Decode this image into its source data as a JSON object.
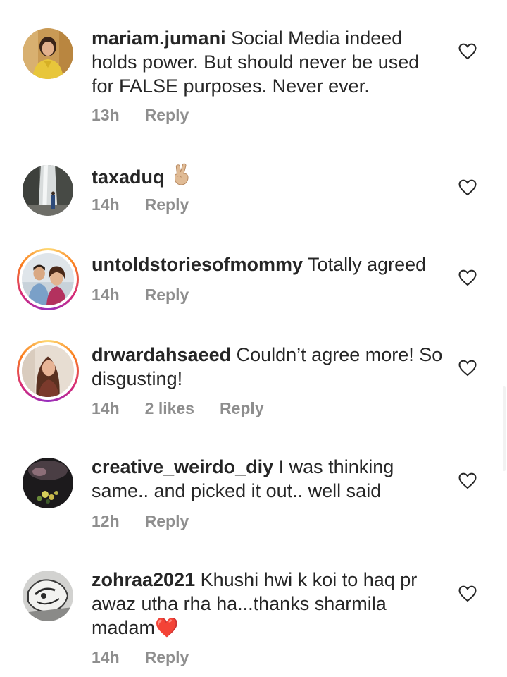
{
  "comments": [
    {
      "username": "mariam.jumani",
      "text": "Social Media indeed holds power. But should never be used for FALSE purposes. Never ever.",
      "time": "13h",
      "likes": "",
      "reply": "Reply",
      "avatar": "woman-yellow-dress-photo",
      "story_ring": false
    },
    {
      "username": "taxaduq",
      "text": "✌️",
      "time": "14h",
      "likes": "",
      "reply": "Reply",
      "avatar": "waterfall-person-photo",
      "story_ring": false
    },
    {
      "username": "untoldstoriesofmommy",
      "text": "Totally agreed",
      "time": "14h",
      "likes": "",
      "reply": "Reply",
      "avatar": "couple-photo",
      "story_ring": true
    },
    {
      "username": "drwardahsaeed",
      "text": "Couldn’t agree more! So disgusting!",
      "time": "14h",
      "likes": "2 likes",
      "reply": "Reply",
      "avatar": "woman-portrait-photo",
      "story_ring": true
    },
    {
      "username": "creative_weirdo_diy",
      "text": "I was thinking same.. and picked it out.. well said",
      "time": "12h",
      "likes": "",
      "reply": "Reply",
      "avatar": "dark-flowers-photo",
      "story_ring": false
    },
    {
      "username": "zohraa2021",
      "text": "Khushi hwi k koi to haq pr awaz utha rha ha...thanks sharmila madam❤️",
      "time": "14h",
      "likes": "",
      "reply": "Reply",
      "avatar": "sketch-drawing-photo",
      "story_ring": false
    }
  ],
  "icons": {
    "like": "heart-outline-icon",
    "heart_color": "#e0192b",
    "meta_color": "#8e8e8e",
    "text_color": "#262626"
  }
}
